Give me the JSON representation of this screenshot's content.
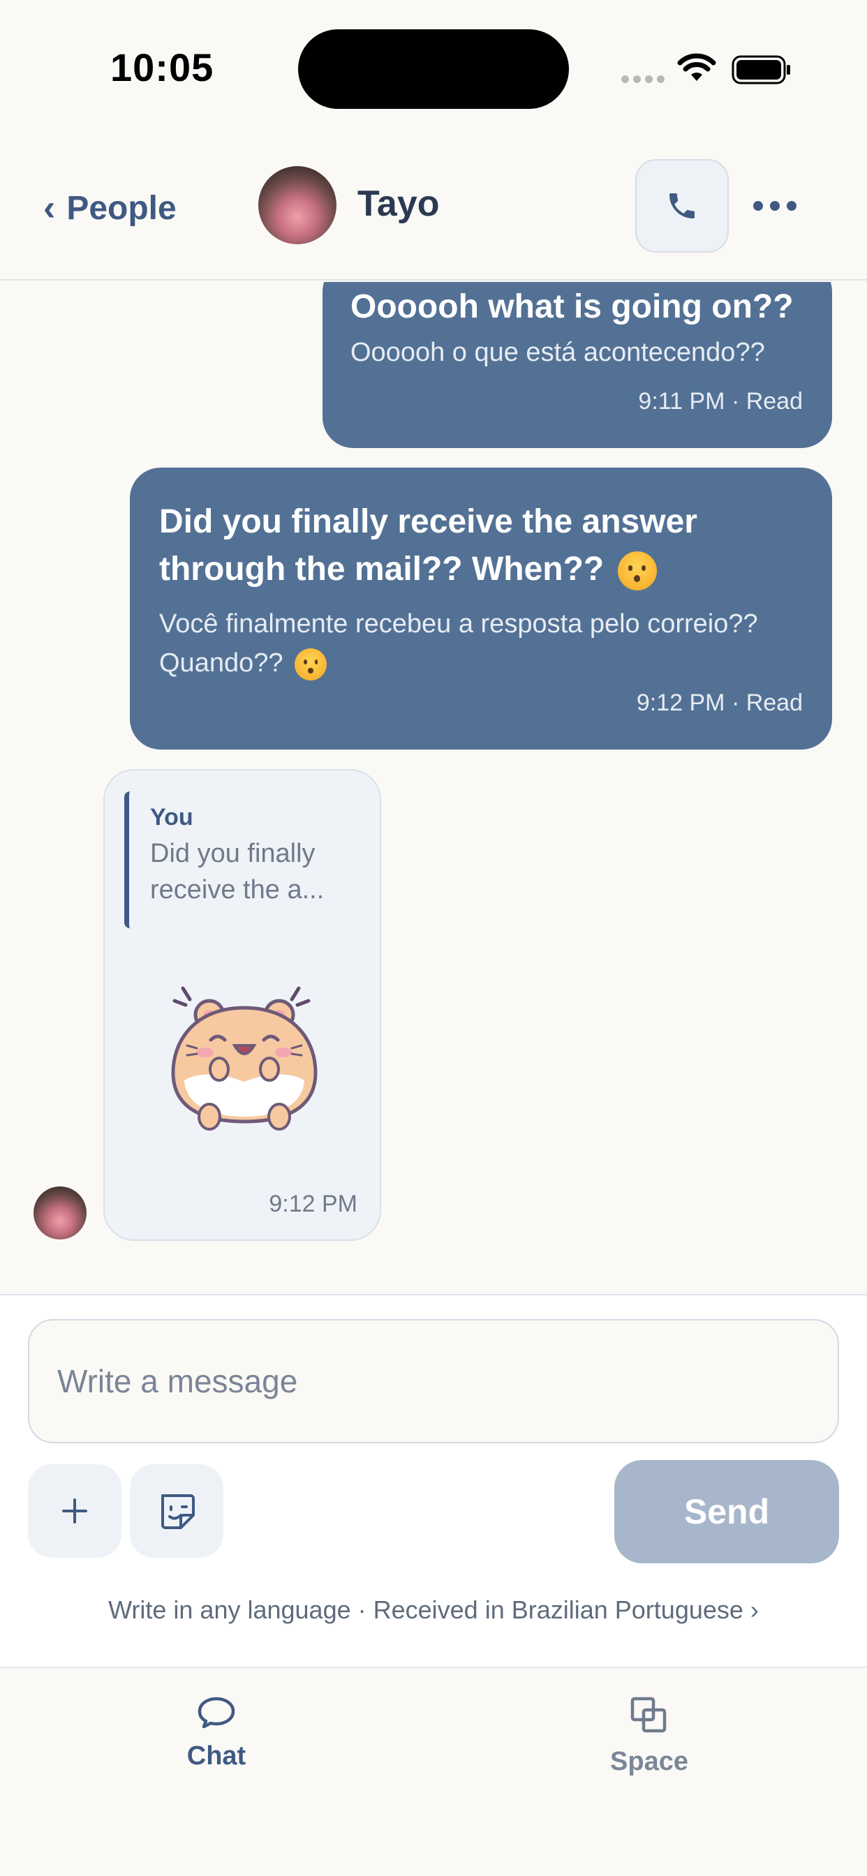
{
  "status_bar": {
    "time": "10:05"
  },
  "header": {
    "back_label": "People",
    "back_chevron": "‹",
    "contact_name": "Tayo",
    "call_icon": "phone-icon",
    "more_icon": "more-horizontal-icon"
  },
  "messages": [
    {
      "direction": "outgoing",
      "text": "Oooooh what is going on??",
      "translation": "Oooooh o que está acontecendo??",
      "meta": "9:11 PM · Read"
    },
    {
      "direction": "outgoing",
      "text": "Did you finally receive the answer through the mail?? When??",
      "translation": "Você finalmente recebeu a resposta pelo correio?? Quando??",
      "meta": "9:12 PM · Read",
      "emoji": "hushed-face"
    },
    {
      "direction": "incoming",
      "quote_author": "You",
      "quote_text": "Did you finally receive the a...",
      "sticker": "happy-hamster-sticker",
      "meta": "9:12 PM"
    }
  ],
  "composer": {
    "placeholder": "Write a message",
    "send_label": "Send",
    "plus_icon": "plus-icon",
    "sticker_icon": "sticker-icon",
    "language_note": "Write in any language · Received in Brazilian Portuguese",
    "language_chevron": "›"
  },
  "tabs": [
    {
      "label": "Chat",
      "icon": "chat-bubble-icon",
      "active": true
    },
    {
      "label": "Space",
      "icon": "space-icon",
      "active": false
    }
  ],
  "colors": {
    "accent": "#3f5a82",
    "outgoing_bubble": "#537195",
    "send_disabled": "#a7b6ca",
    "background": "#fbf9f6"
  }
}
